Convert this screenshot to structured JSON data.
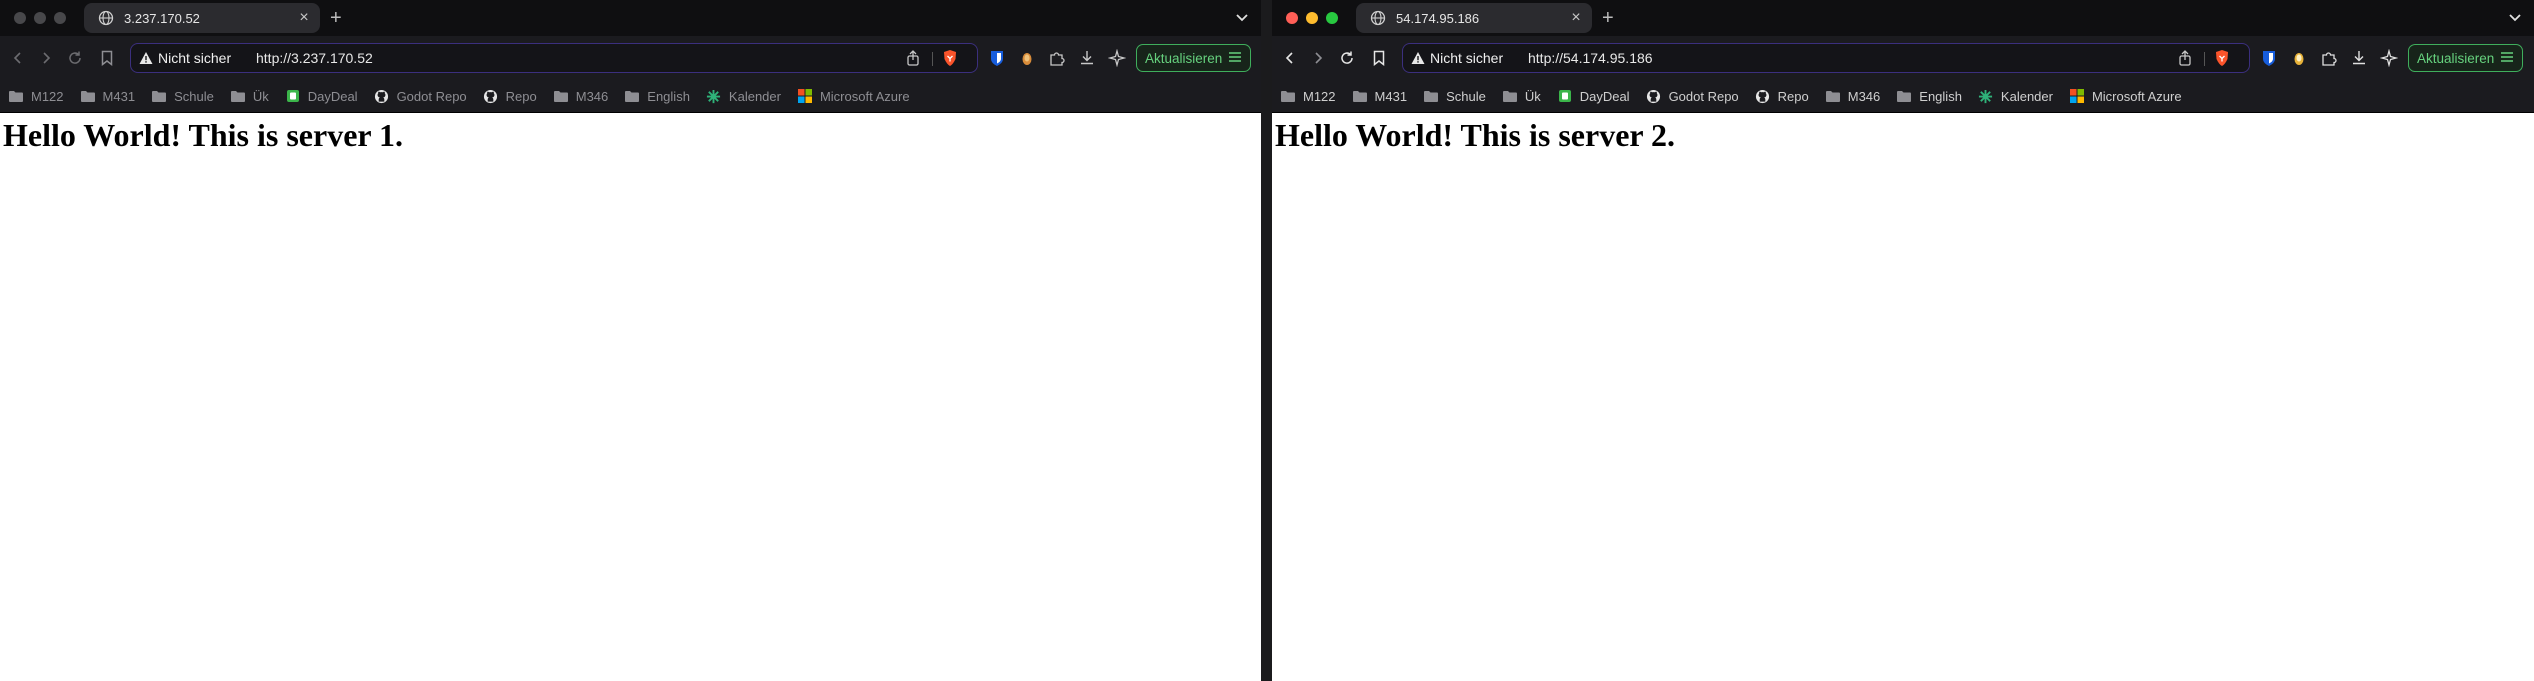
{
  "colors": {
    "accent_green": "#3fae5c",
    "url_border": "#3b2f7e",
    "toolbar_bg": "#1b1b1f"
  },
  "bookmarks": [
    {
      "label": "M122",
      "icon": "folder-icon"
    },
    {
      "label": "M431",
      "icon": "folder-icon"
    },
    {
      "label": "Schule",
      "icon": "folder-icon"
    },
    {
      "label": "Ük",
      "icon": "folder-icon"
    },
    {
      "label": "DayDeal",
      "icon": "daydeal-icon"
    },
    {
      "label": "Godot Repo",
      "icon": "github-icon"
    },
    {
      "label": "Repo",
      "icon": "github-icon"
    },
    {
      "label": "M346",
      "icon": "folder-icon"
    },
    {
      "label": "English",
      "icon": "folder-icon"
    },
    {
      "label": "Kalender",
      "icon": "calendar-icon"
    },
    {
      "label": "Microsoft Azure",
      "icon": "microsoft-icon"
    }
  ],
  "window1": {
    "tab_title": "3.237.170.52",
    "security_label": "Nicht sicher",
    "url": "http://3.237.170.52",
    "update_button": "Aktualisieren",
    "heading": "Hello World! This is server 1."
  },
  "window2": {
    "tab_title": "54.174.95.186",
    "security_label": "Nicht sicher",
    "url": "http://54.174.95.186",
    "update_button": "Aktualisieren",
    "heading": "Hello World! This is server 2."
  }
}
